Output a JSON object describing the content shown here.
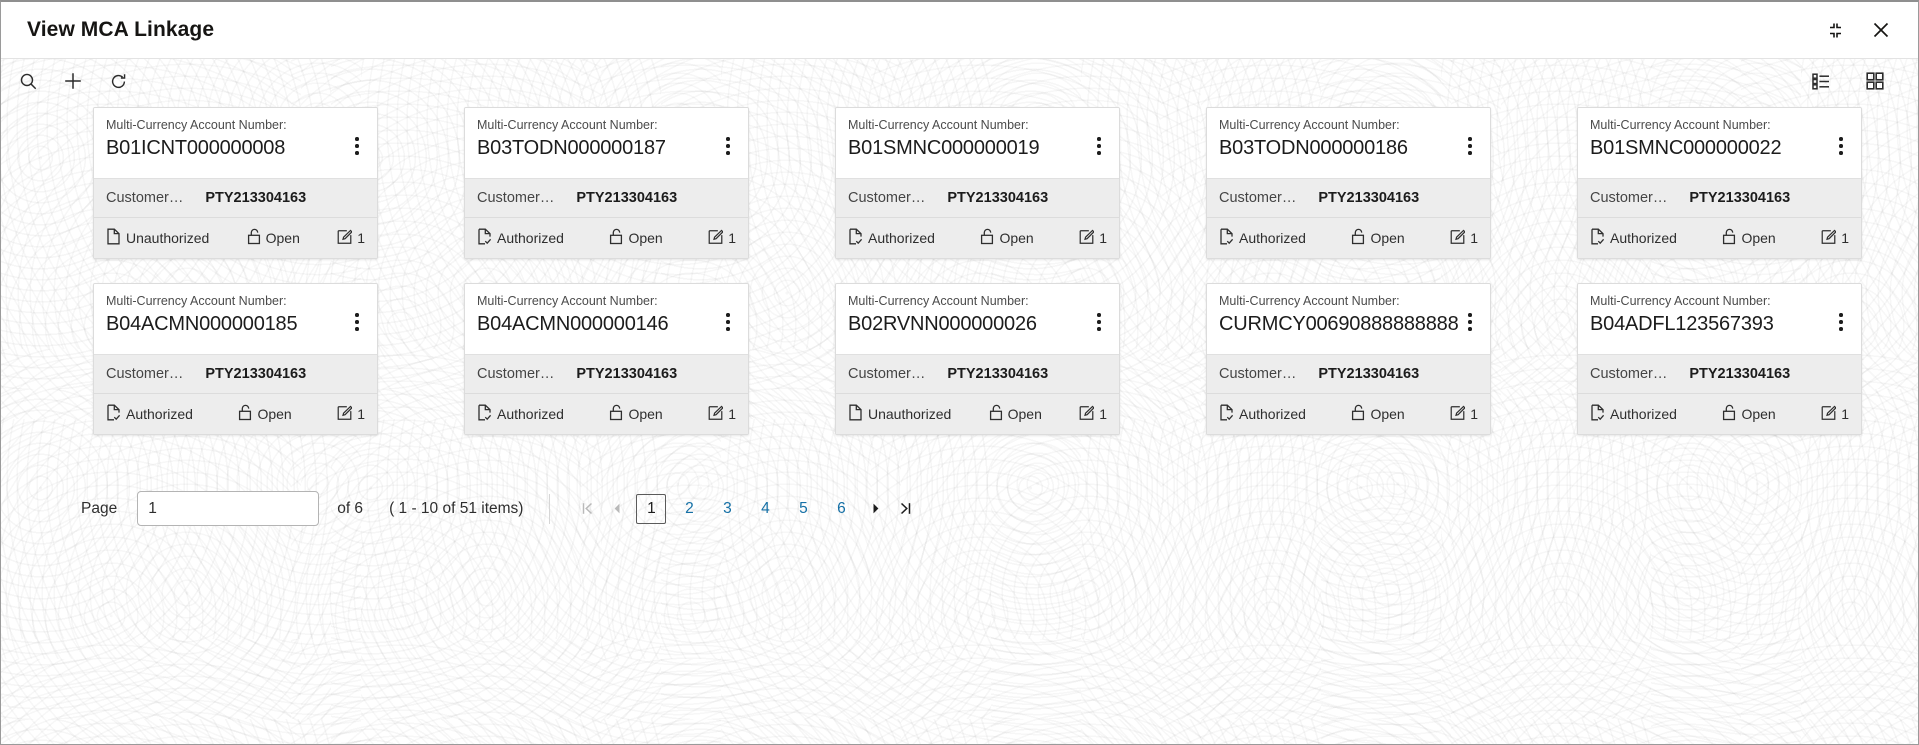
{
  "window": {
    "title": "View MCA Linkage",
    "minimize_icon": "collapse-icon",
    "close_icon": "close-icon"
  },
  "toolbar": {
    "search_icon": "search-icon",
    "add_icon": "plus-icon",
    "refresh_icon": "refresh-icon",
    "list_view_icon": "list-view-icon",
    "grid_view_icon": "grid-view-icon"
  },
  "card_fields": {
    "account_label": "Multi-Currency Account Number:",
    "customer_label": "Customer…"
  },
  "cards": [
    {
      "account_number": "B01ICNT000000008",
      "customer_label": "Customer…",
      "customer_value": "PTY213304163",
      "auth_status": "Unauthorized",
      "record_status": "Open",
      "mod_count": "1"
    },
    {
      "account_number": "B03TODN000000187",
      "customer_label": "Customer…",
      "customer_value": "PTY213304163",
      "auth_status": "Authorized",
      "record_status": "Open",
      "mod_count": "1"
    },
    {
      "account_number": "B01SMNC000000019",
      "customer_label": "Customer…",
      "customer_value": "PTY213304163",
      "auth_status": "Authorized",
      "record_status": "Open",
      "mod_count": "1"
    },
    {
      "account_number": "B03TODN000000186",
      "customer_label": "Customer…",
      "customer_value": "PTY213304163",
      "auth_status": "Authorized",
      "record_status": "Open",
      "mod_count": "1"
    },
    {
      "account_number": "B01SMNC000000022",
      "customer_label": "Customer…",
      "customer_value": "PTY213304163",
      "auth_status": "Authorized",
      "record_status": "Open",
      "mod_count": "1"
    },
    {
      "account_number": "B04ACMN000000185",
      "customer_label": "Customer…",
      "customer_value": "PTY213304163",
      "auth_status": "Authorized",
      "record_status": "Open",
      "mod_count": "1"
    },
    {
      "account_number": "B04ACMN000000146",
      "customer_label": "Customer…",
      "customer_value": "PTY213304163",
      "auth_status": "Authorized",
      "record_status": "Open",
      "mod_count": "1"
    },
    {
      "account_number": "B02RVNN000000026",
      "customer_label": "Customer…",
      "customer_value": "PTY213304163",
      "auth_status": "Unauthorized",
      "record_status": "Open",
      "mod_count": "1"
    },
    {
      "account_number": "CURMCY00690888888888",
      "customer_label": "Customer…",
      "customer_value": "PTY213304163",
      "auth_status": "Authorized",
      "record_status": "Open",
      "mod_count": "1"
    },
    {
      "account_number": "B04ADFL123567393",
      "customer_label": "Customer…",
      "customer_value": "PTY213304163",
      "auth_status": "Authorized",
      "record_status": "Open",
      "mod_count": "1"
    }
  ],
  "pagination": {
    "page_label": "Page",
    "page_value": "1",
    "of_label": "of 6",
    "items_label": "( 1 - 10 of 51 items)",
    "pages": [
      "1",
      "2",
      "3",
      "4",
      "5",
      "6"
    ],
    "current_page": "1",
    "first_icon": "first-page-icon",
    "prev_icon": "previous-page-icon",
    "next_icon": "next-page-icon",
    "last_icon": "last-page-icon"
  },
  "colors": {
    "link": "#1570a6",
    "card_subsection": "#ededed",
    "text_primary": "#1c1c1c"
  }
}
